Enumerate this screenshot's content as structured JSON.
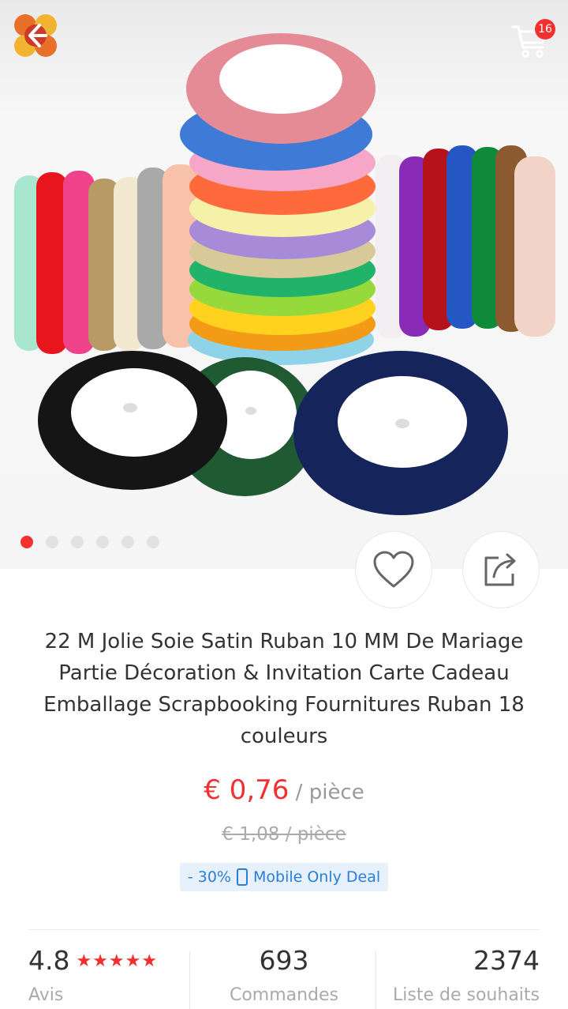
{
  "header": {
    "cart_count": "16",
    "icons": {
      "back": "back-arrow-icon",
      "cart": "shopping-cart-icon"
    }
  },
  "gallery": {
    "image_count": 6,
    "active_index": 0,
    "accent_color": "#f23030"
  },
  "actions": {
    "wishlist_icon": "heart-icon",
    "share_icon": "share-icon"
  },
  "product": {
    "title": "22 M Jolie Soie Satin Ruban 10 MM De Mariage Partie Décoration & Invitation Carte Cadeau Emballage Scrapbooking Fournitures Ruban 18 couleurs",
    "price": "€ 0,76",
    "price_unit": " / pièce",
    "original_price": "€ 1,08  / pièce",
    "deal_discount": "- 30%",
    "deal_label": "Mobile Only Deal"
  },
  "stats": {
    "rating": "4.8",
    "rating_stars": "★★★★★",
    "rating_label": "Avis",
    "orders": "693",
    "orders_label": "Commandes",
    "wishlist": "2374",
    "wishlist_label": "Liste de souhaits"
  }
}
